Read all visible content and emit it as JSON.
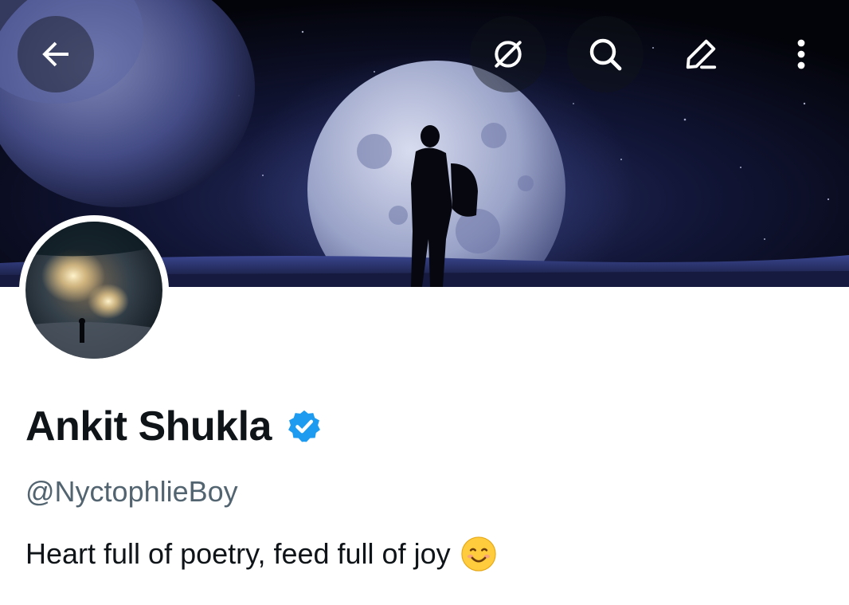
{
  "header": {
    "back_icon": "arrow-left-icon",
    "actions": [
      {
        "icon": "grok-icon"
      },
      {
        "icon": "search-icon"
      },
      {
        "icon": "edit-icon"
      },
      {
        "icon": "more-vertical-icon"
      }
    ]
  },
  "profile": {
    "name": "Ankit Shukla",
    "verified_badge": "verified-badge-icon",
    "handle": "@NyctophlieBoy",
    "bio": "Heart full of poetry, feed full of joy",
    "bio_emoji": "smiling-face-icon"
  },
  "colors": {
    "name": "#0f1419",
    "secondary_text": "#536471",
    "verified": "#1d9bf0",
    "banner_sky": "#0a0d22",
    "moon": "#aeb6d6"
  }
}
